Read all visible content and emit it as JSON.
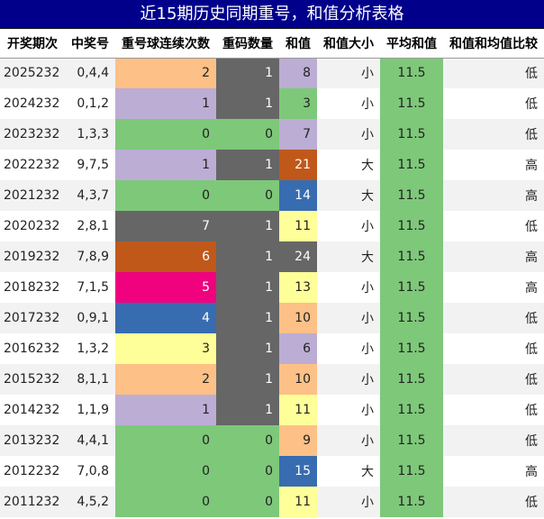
{
  "title": "近15期历史同期重号，和值分析表格",
  "columns": [
    "开奖期次",
    "中奖号",
    "重号球连续次数",
    "重码数量",
    "和值",
    "和值大小",
    "平均和值",
    "和值和均值比较"
  ],
  "colors": {
    "title_bg": "#00008b",
    "avg_bg": "#7ec87a",
    "green": "#7ec87a",
    "gray": "#666666",
    "lavender": "#bcadd4",
    "peach": "#fdc086",
    "orange": "#c0581a",
    "blue": "#386cb0",
    "yellow": "#ffff99",
    "magenta": "#f0027f"
  },
  "rows": [
    {
      "issue": "2025232",
      "numbers": "0,4,4",
      "streak": "2",
      "streak_color": "peach",
      "repeat": "1",
      "repeat_color": "gray",
      "sum": "8",
      "sum_color": "lavender",
      "size": "小",
      "avg": "11.5",
      "compare": "低"
    },
    {
      "issue": "2024232",
      "numbers": "0,1,2",
      "streak": "1",
      "streak_color": "lavender",
      "repeat": "1",
      "repeat_color": "gray",
      "sum": "3",
      "sum_color": "green",
      "size": "小",
      "avg": "11.5",
      "compare": "低"
    },
    {
      "issue": "2023232",
      "numbers": "1,3,3",
      "streak": "0",
      "streak_color": "green",
      "repeat": "0",
      "repeat_color": "green",
      "sum": "7",
      "sum_color": "lavender",
      "size": "小",
      "avg": "11.5",
      "compare": "低"
    },
    {
      "issue": "2022232",
      "numbers": "9,7,5",
      "streak": "1",
      "streak_color": "lavender",
      "repeat": "1",
      "repeat_color": "gray",
      "sum": "21",
      "sum_color": "orange",
      "size": "大",
      "avg": "11.5",
      "compare": "高"
    },
    {
      "issue": "2021232",
      "numbers": "4,3,7",
      "streak": "0",
      "streak_color": "green",
      "repeat": "0",
      "repeat_color": "green",
      "sum": "14",
      "sum_color": "blue",
      "size": "大",
      "avg": "11.5",
      "compare": "高"
    },
    {
      "issue": "2020232",
      "numbers": "2,8,1",
      "streak": "7",
      "streak_color": "gray",
      "repeat": "1",
      "repeat_color": "gray",
      "sum": "11",
      "sum_color": "yellow",
      "size": "小",
      "avg": "11.5",
      "compare": "低"
    },
    {
      "issue": "2019232",
      "numbers": "7,8,9",
      "streak": "6",
      "streak_color": "orange",
      "repeat": "1",
      "repeat_color": "gray",
      "sum": "24",
      "sum_color": "gray",
      "size": "大",
      "avg": "11.5",
      "compare": "高"
    },
    {
      "issue": "2018232",
      "numbers": "7,1,5",
      "streak": "5",
      "streak_color": "magenta",
      "repeat": "1",
      "repeat_color": "gray",
      "sum": "13",
      "sum_color": "yellow",
      "size": "小",
      "avg": "11.5",
      "compare": "高"
    },
    {
      "issue": "2017232",
      "numbers": "0,9,1",
      "streak": "4",
      "streak_color": "blue",
      "repeat": "1",
      "repeat_color": "gray",
      "sum": "10",
      "sum_color": "peach",
      "size": "小",
      "avg": "11.5",
      "compare": "低"
    },
    {
      "issue": "2016232",
      "numbers": "1,3,2",
      "streak": "3",
      "streak_color": "yellow",
      "repeat": "1",
      "repeat_color": "gray",
      "sum": "6",
      "sum_color": "lavender",
      "size": "小",
      "avg": "11.5",
      "compare": "低"
    },
    {
      "issue": "2015232",
      "numbers": "8,1,1",
      "streak": "2",
      "streak_color": "peach",
      "repeat": "1",
      "repeat_color": "gray",
      "sum": "10",
      "sum_color": "peach",
      "size": "小",
      "avg": "11.5",
      "compare": "低"
    },
    {
      "issue": "2014232",
      "numbers": "1,1,9",
      "streak": "1",
      "streak_color": "lavender",
      "repeat": "1",
      "repeat_color": "gray",
      "sum": "11",
      "sum_color": "yellow",
      "size": "小",
      "avg": "11.5",
      "compare": "低"
    },
    {
      "issue": "2013232",
      "numbers": "4,4,1",
      "streak": "0",
      "streak_color": "green",
      "repeat": "0",
      "repeat_color": "green",
      "sum": "9",
      "sum_color": "peach",
      "size": "小",
      "avg": "11.5",
      "compare": "低"
    },
    {
      "issue": "2012232",
      "numbers": "7,0,8",
      "streak": "0",
      "streak_color": "green",
      "repeat": "0",
      "repeat_color": "green",
      "sum": "15",
      "sum_color": "blue",
      "size": "大",
      "avg": "11.5",
      "compare": "高"
    },
    {
      "issue": "2011232",
      "numbers": "4,5,2",
      "streak": "0",
      "streak_color": "green",
      "repeat": "0",
      "repeat_color": "green",
      "sum": "11",
      "sum_color": "yellow",
      "size": "小",
      "avg": "11.5",
      "compare": "低"
    }
  ]
}
